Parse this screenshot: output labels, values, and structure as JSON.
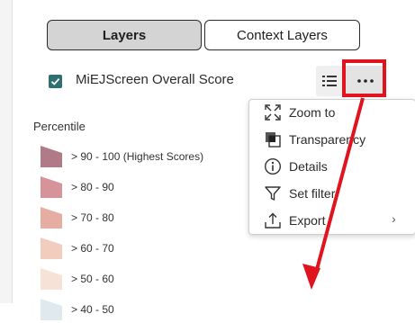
{
  "tabs": {
    "layers": "Layers",
    "context_layers": "Context Layers"
  },
  "layer": {
    "title": "MiEJScreen Overall Score",
    "checked": true
  },
  "legend": {
    "heading": "Percentile",
    "items": [
      {
        "label": "> 90 - 100 (Highest Scores)",
        "color": "#b07b86"
      },
      {
        "label": "> 80 - 90",
        "color": "#d6939a"
      },
      {
        "label": "> 70 - 80",
        "color": "#e6ada3"
      },
      {
        "label": "> 60 - 70",
        "color": "#f2cdbd"
      },
      {
        "label": "> 50 - 60",
        "color": "#f7e2d8"
      },
      {
        "label": "> 40 - 50",
        "color": "#dfe9ee"
      }
    ]
  },
  "menu": {
    "items": [
      {
        "label": "Zoom to",
        "icon": "zoom-to-icon"
      },
      {
        "label": "Transparency",
        "icon": "transparency-icon"
      },
      {
        "label": "Details",
        "icon": "info-icon"
      },
      {
        "label": "Set filter",
        "icon": "filter-icon"
      },
      {
        "label": "Export",
        "icon": "export-icon",
        "submenu": true
      }
    ]
  },
  "annotation": {
    "highlight_color": "#e0141e"
  }
}
